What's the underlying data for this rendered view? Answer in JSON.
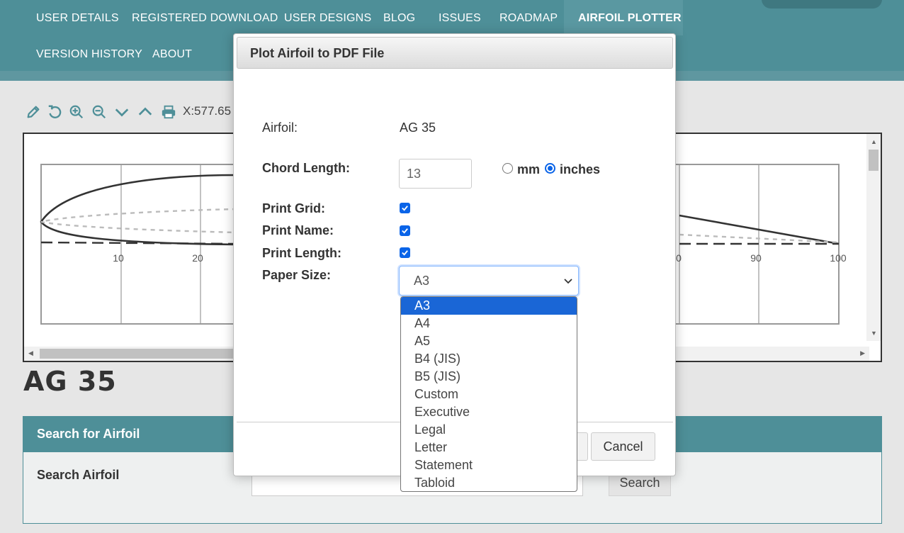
{
  "nav": {
    "row1": [
      "USER DETAILS",
      "REGISTERED DOWNLOAD",
      "USER DESIGNS",
      "BLOG",
      "ISSUES",
      "ROADMAP",
      "AIRFOIL PLOTTER"
    ],
    "row2": [
      "VERSION HISTORY",
      "ABOUT"
    ],
    "active": "AIRFOIL PLOTTER"
  },
  "toolbar": {
    "icons": [
      "pencil-icon",
      "undo-icon",
      "zoom-in-icon",
      "zoom-out-icon",
      "chevron-down-icon",
      "chevron-up-icon",
      "print-icon"
    ],
    "coordinate": "X:577.65"
  },
  "plot": {
    "x_tick_labels": [
      "10",
      "20",
      "0",
      "90",
      "100"
    ]
  },
  "airfoil_name": "AG 35",
  "search": {
    "heading": "Search for Airfoil",
    "label": "Search Airfoil",
    "button": "Search"
  },
  "modal": {
    "title": "Plot Airfoil to PDF File",
    "airfoil_label": "Airfoil:",
    "airfoil_value": "AG 35",
    "chord_label": "Chord Length:",
    "chord_value": "13",
    "unit_mm": "mm",
    "unit_inches": "inches",
    "unit_selected": "inches",
    "print_grid_label": "Print Grid:",
    "print_grid": true,
    "print_name_label": "Print Name:",
    "print_name": true,
    "print_length_label": "Print Length:",
    "print_length": true,
    "paper_size_label": "Paper Size:",
    "paper_size_value": "A3",
    "cancel_button": "Cancel"
  },
  "paper_sizes": [
    "A3",
    "A4",
    "A5",
    "B4 (JIS)",
    "B5 (JIS)",
    "Custom",
    "Executive",
    "Legal",
    "Letter",
    "Statement",
    "Tabloid"
  ],
  "colors": {
    "nav_bg": "#4e8f98",
    "accent_blue": "#1a66d6"
  }
}
